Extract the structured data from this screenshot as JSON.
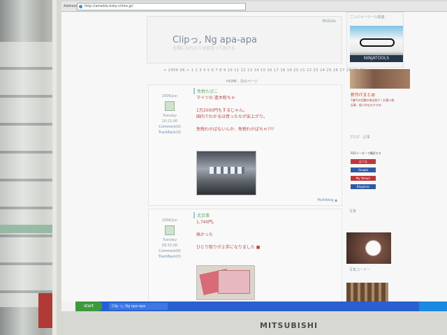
{
  "browser": {
    "address_label": "Address",
    "url": "http://ameblo.ksky-clinto.jp/"
  },
  "blog": {
    "top_link": "Mobile",
    "title": "Clipっ, Ng apa-apa",
    "subtitle": "全開になれたら全部言ってあげる",
    "calendar_text": "< 2006 06 > 1 2 3 4 5 6 7 8 9 10 11 12 13 14 15 16 17 18 19 20 21 22 23 24 25 26 27 28 29 30",
    "breadcrumb": "HOME · 次のページ"
  },
  "posts": [
    {
      "heading": "免税たばこ",
      "date": "2006/Jun",
      "day": "Tuesday",
      "time": "10:21:00",
      "comment_link": "Comment(0)",
      "trackback_link": "TrackBack(0)",
      "lines": [
        "マイツの 進木粉ちゃ",
        "",
        "1万2000円もするじゃん。",
        "国内でわかるは買ったちが安上がり。",
        "",
        "免税わかばないんか、免税わかばちゃ???"
      ],
      "more_link": "Multiblog ▲"
    },
    {
      "heading": "北京事",
      "date": "2006/Jun",
      "day": "Tuesday",
      "time": "09:15:00",
      "comment_link": "Comment(0)",
      "trackback_link": "TrackBack(0)",
      "lines": [
        "1,740円。",
        "",
        "高かった",
        "",
        "ひとり取りが上手になりました ■"
      ],
      "more_link": ""
    }
  ],
  "sidebar": {
    "top_title": "ニンジャーツール関連",
    "ad_band": "NINJATOOLS",
    "ad_headline": "新作ITまとめ",
    "ad_small": "1億円の話題の商品紹介 / お買い物",
    "ad_more": "記事 · 個人的なおすすめ",
    "links_title": "ブログ · 記事",
    "feed_title": "RSSリーダーで購読する",
    "feed_buttons": [
      "はてな",
      "Google",
      "My Yahoo!",
      "Bloglines"
    ],
    "section_label": "写真",
    "photo_label": "写真コーナー"
  },
  "taskbar": {
    "start_label": "start",
    "task_label": "Clip っ, Ng apa-apa"
  },
  "monitor": {
    "brand": "MITSUBISHI"
  },
  "colors": {
    "taskbar_blue": "#2a5fd1",
    "start_green": "#3c9a3c",
    "accent_red": "#b64a4a"
  }
}
